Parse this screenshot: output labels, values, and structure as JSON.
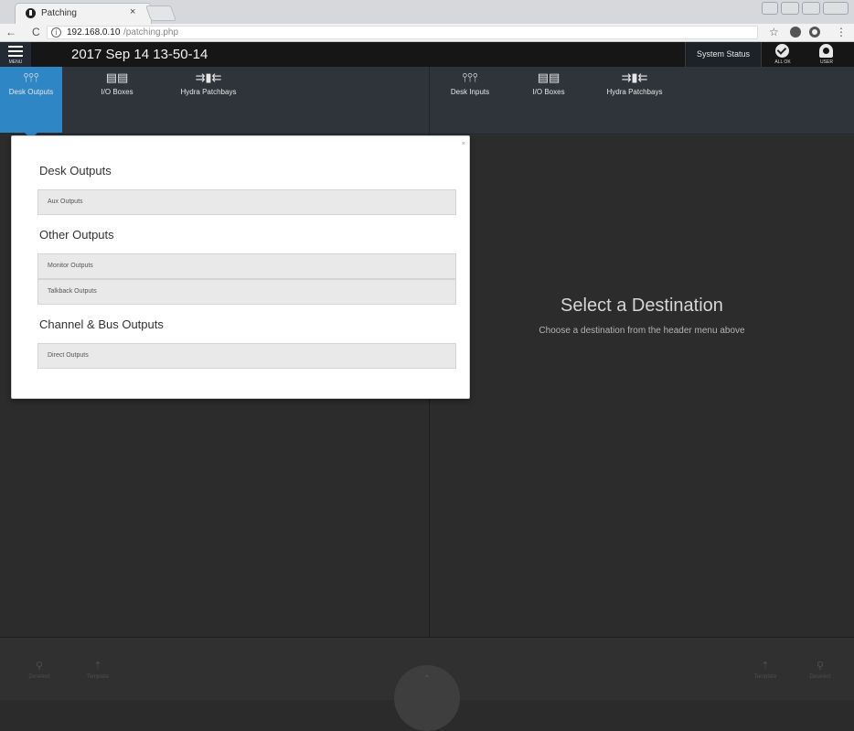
{
  "browser": {
    "tab_title": "Patching",
    "tab_close": "×",
    "url_host": "192.168.0.10",
    "url_path": "/patching.php",
    "info_icon": "i",
    "back_glyph": "←",
    "forward_glyph": "→",
    "reload_glyph": "C",
    "star_glyph": "☆",
    "kebab_glyph": "⋮"
  },
  "header": {
    "menu_label": "MENU",
    "datetime": "2017 Sep 14 13-50-14",
    "system_status": "System Status",
    "all_ok_label": "ALL OK",
    "user_label": "USER"
  },
  "left_tabs": [
    {
      "label": "Desk Outputs",
      "icon": "faders-icon",
      "glyph": "⫯⫯⫯",
      "active": true
    },
    {
      "label": "I/O Boxes",
      "icon": "io-box-icon",
      "glyph": "▤▤",
      "active": false
    },
    {
      "label": "Hydra Patchbays",
      "icon": "patchbay-icon",
      "glyph": "⇉▮⇇",
      "active": false
    }
  ],
  "right_tabs": [
    {
      "label": "Desk Inputs",
      "icon": "faders-icon",
      "glyph": "⫯⫯⫯"
    },
    {
      "label": "I/O Boxes",
      "icon": "io-box-icon",
      "glyph": "▤▤"
    },
    {
      "label": "Hydra Patchbays",
      "icon": "patchbay-icon",
      "glyph": "⇉▮⇇"
    }
  ],
  "dropdown": {
    "close_glyph": "×",
    "sections": [
      {
        "title": "Desk Outputs",
        "items": [
          "Aux Outputs"
        ]
      },
      {
        "title": "Other Outputs",
        "items": [
          "Monitor Outputs",
          "Talkback Outputs"
        ]
      },
      {
        "title": "Channel & Bus Outputs",
        "items": [
          "Direct Outputs"
        ]
      }
    ]
  },
  "destination": {
    "title": "Select a Destination",
    "subtitle": "Choose a destination from the header menu above"
  },
  "bottombar": {
    "left_items": [
      {
        "label": "Deselect",
        "glyph": "⚲"
      },
      {
        "label": "Template",
        "glyph": "⇡"
      }
    ],
    "center_label": "",
    "center_glyph": "⌃",
    "right_items": [
      {
        "label": "Template",
        "glyph": "⇡"
      },
      {
        "label": "Deselect",
        "glyph": "⚲"
      }
    ]
  }
}
